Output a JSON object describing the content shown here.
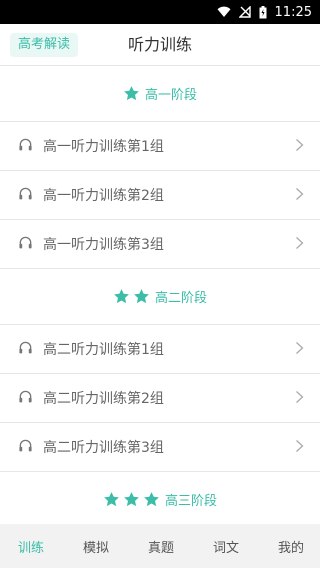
{
  "status_bar": {
    "time": "11:25"
  },
  "header": {
    "badge_label": "高考解读",
    "title": "听力训练"
  },
  "sections": [
    {
      "title": "高一阶段",
      "stars": 1,
      "items": [
        "高一听力训练第1组",
        "高一听力训练第2组",
        "高一听力训练第3组"
      ]
    },
    {
      "title": "高二阶段",
      "stars": 2,
      "items": [
        "高二听力训练第1组",
        "高二听力训练第2组",
        "高二听力训练第3组"
      ]
    },
    {
      "title": "高三阶段",
      "stars": 3,
      "items": []
    }
  ],
  "tabs": [
    "训练",
    "模拟",
    "真题",
    "词文",
    "我的"
  ],
  "active_tab": 0,
  "colors": {
    "accent": "#3bbda8",
    "badge_bg": "#e9f7f5",
    "tab_bar_bg": "#f2f2f2"
  },
  "icons": {
    "section": "star-icon",
    "item": "headphones-icon",
    "item_trailing": "chevron-right-icon"
  }
}
